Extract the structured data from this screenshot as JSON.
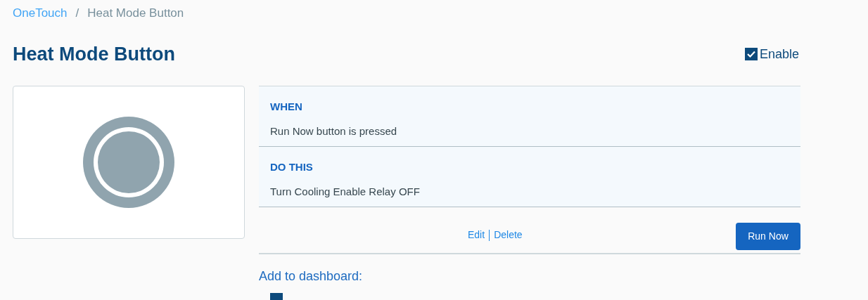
{
  "breadcrumb": [
    {
      "label": "OneTouch",
      "kind": "link"
    },
    {
      "label": "/",
      "kind": "separator"
    },
    {
      "label": "Heat Mode Button",
      "kind": "current"
    }
  ],
  "title": "Heat Mode Button",
  "enable": {
    "label": "Enable",
    "checked": true
  },
  "sections": [
    {
      "heading": "WHEN",
      "text": "Run Now button is pressed"
    },
    {
      "heading": "DO THIS",
      "text": "Turn Cooling Enable Relay OFF"
    }
  ],
  "links": [
    "Edit",
    "Delete"
  ],
  "run_button": "Run Now",
  "dashboard_label": "Add to dashboard:",
  "dashboard_option": {
    "checked": true
  }
}
